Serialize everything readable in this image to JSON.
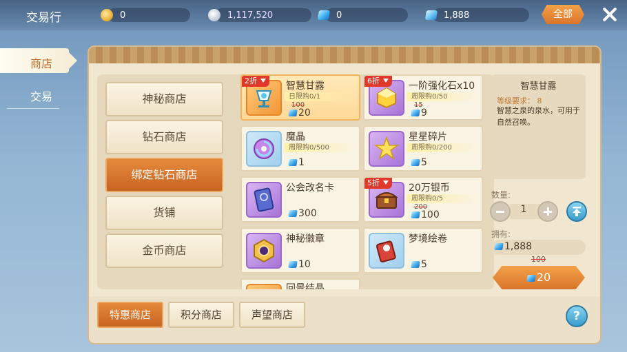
{
  "header": {
    "title": "交易行",
    "currencies": [
      {
        "icon": "gold-coin-icon",
        "value": "0"
      },
      {
        "icon": "silver-coin-icon",
        "value": "1,117,520"
      },
      {
        "icon": "diamond-icon",
        "value": "0"
      },
      {
        "icon": "bound-diamond-icon",
        "value": "1,888"
      }
    ],
    "all_label": "全部"
  },
  "left_tabs": [
    {
      "label": "商店",
      "active": true
    },
    {
      "label": "交易",
      "active": false
    }
  ],
  "categories": [
    {
      "label": "神秘商店"
    },
    {
      "label": "钻石商店"
    },
    {
      "label": "绑定钻石商店",
      "active": true
    },
    {
      "label": "货铺"
    },
    {
      "label": "金币商店"
    }
  ],
  "items": [
    {
      "name": "智慧甘露",
      "discount": "2折",
      "limit": "日限购0/1",
      "old_price": "100",
      "price": "20",
      "selected": true,
      "icon": "elixir-chalice-icon"
    },
    {
      "name": "一阶强化石x10",
      "discount": "6折",
      "limit": "周限购0/50",
      "old_price": "15",
      "price": "9",
      "icon": "enhance-stone-icon"
    },
    {
      "name": "魔晶",
      "limit": "周限购0/500",
      "price": "1",
      "icon": "magic-crystal-icon"
    },
    {
      "name": "星星碎片",
      "limit": "周限购0/200",
      "price": "5",
      "icon": "star-shard-icon"
    },
    {
      "name": "公会改名卡",
      "price": "300",
      "icon": "rename-card-icon"
    },
    {
      "name": "20万银币",
      "discount": "5折",
      "limit": "周限购0/5",
      "old_price": "200",
      "price": "100",
      "icon": "treasure-chest-icon"
    },
    {
      "name": "神秘徽章",
      "price": "10",
      "icon": "mystery-badge-icon"
    },
    {
      "name": "梦境绘卷",
      "price": "5",
      "icon": "dream-scroll-icon"
    },
    {
      "name": "回景结晶"
    }
  ],
  "detail": {
    "name": "智慧甘露",
    "level_req": "等级要求：  8",
    "description": "智慧之泉的泉水，可用于自然召唤。",
    "qty_label": "数量:",
    "qty": "1",
    "own_label": "拥有:",
    "own_value": "1,888",
    "old_total": "100",
    "total": "20"
  },
  "bottom_tabs": [
    {
      "label": "特惠商店",
      "active": true
    },
    {
      "label": "积分商店"
    },
    {
      "label": "声望商店"
    }
  ],
  "help_label": "?"
}
